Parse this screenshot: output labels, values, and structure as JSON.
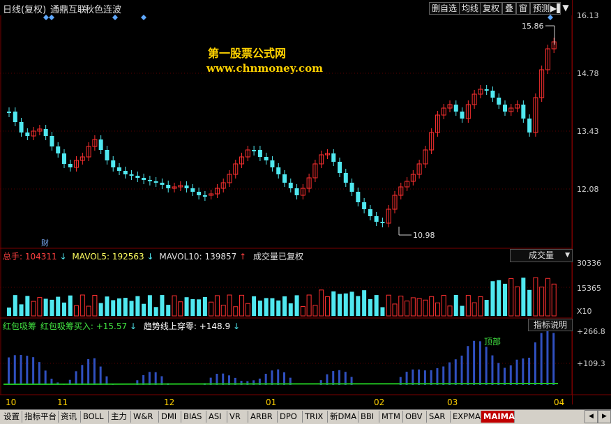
{
  "header": {
    "chart_mode": "日线(复权)",
    "stock_name": "通鼎互联",
    "formula_name": "秋色连波"
  },
  "toolbar": {
    "buttons": [
      "删自选",
      "均线",
      "复权",
      "叠",
      "窗",
      "预测"
    ]
  },
  "watermark": {
    "line1": "第一股票公式网",
    "line2": "www.chnmoney.com"
  },
  "price_panel": {
    "axis_ticks": [
      "16.13",
      "14.78",
      "13.43",
      "12.08"
    ],
    "high_label": "15.86",
    "low_label": "10.98",
    "finance_marker": "财"
  },
  "volume_panel": {
    "total_label": "总手:",
    "total_value": "104311",
    "mavol5_label": "MAVOL5:",
    "mavol5_value": "192563",
    "mavol10_label": "MAVOL10:",
    "mavol10_value": "139857",
    "note": "成交量已复权",
    "selector": "成交量",
    "axis_ticks": [
      "30336",
      "15365",
      "X10"
    ]
  },
  "indicator_panel": {
    "name": "红包吸筹",
    "line1_label": "红包吸筹买入:",
    "line1_value": "+15.57",
    "line2_label": "趋势线上穿零:",
    "line2_value": "+148.9",
    "explain_button": "指标说明",
    "top_annotation": "顶部",
    "axis_ticks": [
      "+266.8",
      "+109.3"
    ]
  },
  "time_axis": {
    "labels": [
      "10",
      "11",
      "12",
      "01",
      "02",
      "03",
      "04"
    ]
  },
  "tabs": [
    "设置",
    "指标平台",
    "资讯",
    "BOLL",
    "主力",
    "W&R",
    "DMI",
    "BIAS",
    "ASI",
    "VR",
    "ARBR",
    "DPO",
    "TRIX",
    "新DMA",
    "BBI",
    "MTM",
    "OBV",
    "SAR",
    "EXPMA",
    "MAIMA"
  ],
  "active_tab": "MAIMA",
  "colors": {
    "up": "#ff3030",
    "down": "#50e8f0",
    "grid": "#7a0000",
    "indicator_bar": "#3050c0",
    "indicator_line": "#ffffff",
    "trend_line": "#20c020",
    "accent_tab": "#c00000"
  },
  "icons": [
    "pin-icon",
    "dropdown-arrow-icon",
    "scroll-left-icon",
    "scroll-right-icon",
    "diamond-marker-icon"
  ]
}
